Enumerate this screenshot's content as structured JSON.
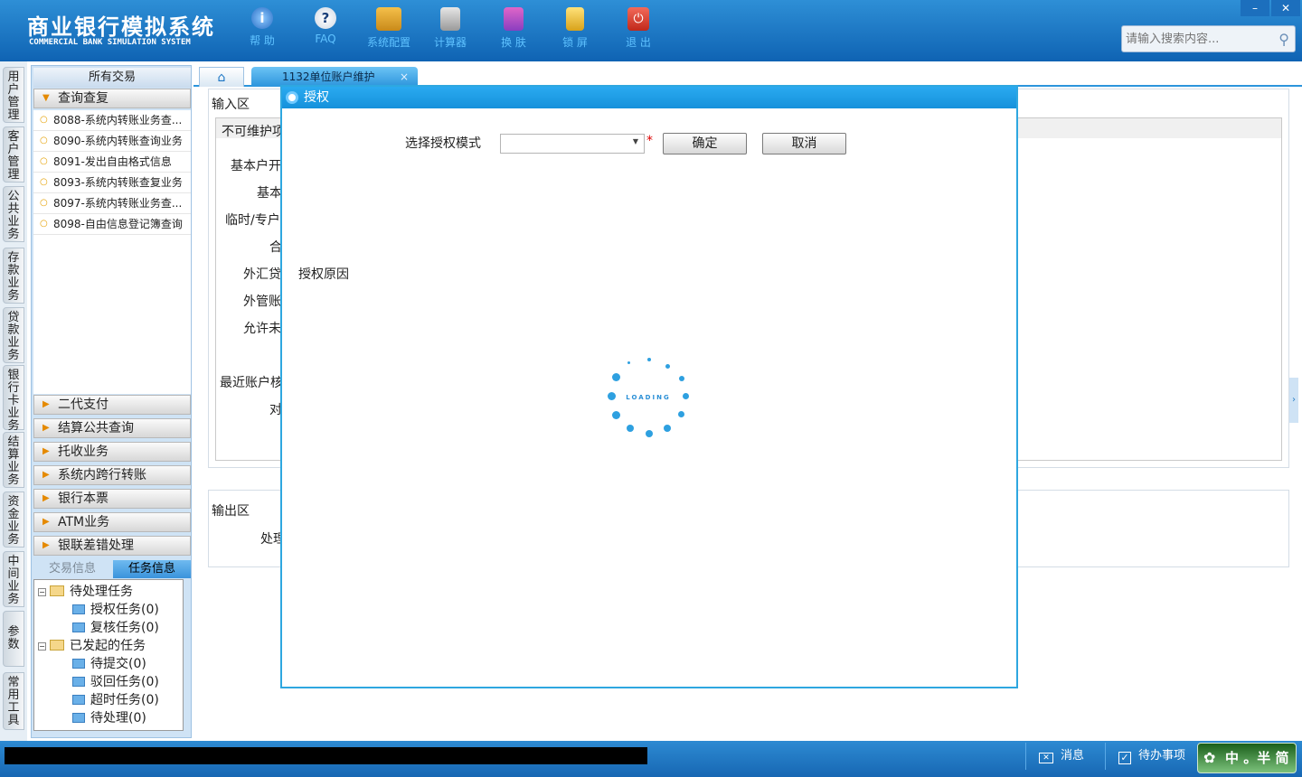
{
  "header": {
    "title": "商业银行模拟系统",
    "subtitle": "COMMERCIAL BANK SIMULATION SYSTEM",
    "toolbar": [
      {
        "label": "帮 助",
        "icon": "info-icon"
      },
      {
        "label": "FAQ",
        "icon": "question-icon"
      },
      {
        "label": "系统配置",
        "icon": "toolbox-icon"
      },
      {
        "label": "计算器",
        "icon": "calculator-icon"
      },
      {
        "label": "换 肤",
        "icon": "shirt-icon"
      },
      {
        "label": "锁 屏",
        "icon": "lock-icon"
      },
      {
        "label": "退 出",
        "icon": "power-icon"
      }
    ],
    "search_placeholder": "请输入搜索内容...",
    "min_label": "–",
    "close_label": "✕"
  },
  "vertical_tabs": [
    "用户管理",
    "客户管理",
    "公共业务",
    "存款业务",
    "贷款业务",
    "银行卡业务",
    "结算业务",
    "资金业务",
    "中间业务",
    "参数",
    "常用工具"
  ],
  "left_panel": {
    "header": "所有交易",
    "expanded_group": "查询查复",
    "items": [
      "8088-系统内转账业务查...",
      "8090-系统内转账查询业务",
      "8091-发出自由格式信息",
      "8093-系统内转账查复业务",
      "8097-系统内转账业务查...",
      "8098-自由信息登记簿查询"
    ],
    "groups": [
      "二代支付",
      "结算公共查询",
      "托收业务",
      "系统内跨行转账",
      "银行本票",
      "ATM业务",
      "银联差错处理"
    ],
    "task_tabs": [
      "交易信息",
      "任务信息"
    ],
    "tree": {
      "pending": "待处理任务",
      "pending_children": [
        "授权任务(0)",
        "复核任务(0)"
      ],
      "started": "已发起的任务",
      "started_children": [
        "待提交(0)",
        "驳回任务(0)",
        "超时任务(0)",
        "待处理(0)"
      ]
    }
  },
  "tabs": {
    "active": "1132单位账户维护",
    "close": "×"
  },
  "form": {
    "input_area": "输入区",
    "non_maintainable": "不可维护项",
    "labels": [
      "基本户开",
      "基本",
      "临时/专户",
      "合",
      "外汇贷",
      "外管账",
      "允许未",
      "最近账户核",
      "对"
    ],
    "output_area": "输出区",
    "output_label": "处理"
  },
  "dialog": {
    "title": "授权",
    "mode_label": "选择授权模式",
    "required": "*",
    "confirm": "确定",
    "cancel": "取消",
    "reason_label": "授权原因",
    "loading": "LOADING"
  },
  "statusbar": {
    "message": "消息",
    "todo": "待办事项",
    "ime": "中 。半 简"
  },
  "colors": {
    "header": "#1776c4",
    "accent": "#2ea7e0",
    "toolbar_text": "#5fc2ff"
  }
}
